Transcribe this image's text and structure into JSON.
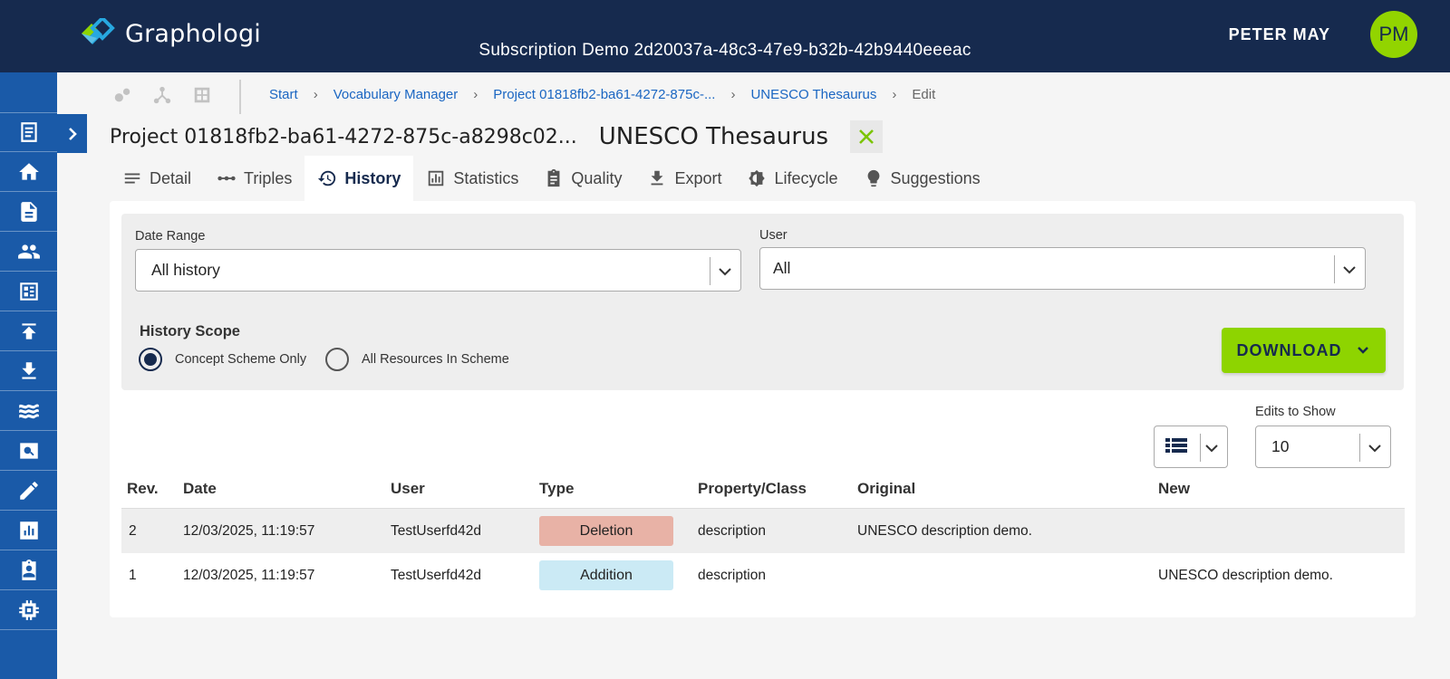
{
  "app": {
    "name": "Graphologi"
  },
  "header": {
    "subscription": "Subscription Demo 2d20037a-48c3-47e9-b32b-42b9440eeeac",
    "user_name": "PETER MAY",
    "avatar_initials": "PM"
  },
  "sidebar": {
    "items": [
      {
        "icon": "vocabulary-icon"
      },
      {
        "icon": "home-icon"
      },
      {
        "icon": "document-icon"
      },
      {
        "icon": "users-icon"
      },
      {
        "icon": "dashboard-icon"
      },
      {
        "icon": "upload-icon"
      },
      {
        "icon": "download-icon"
      },
      {
        "icon": "waves-icon"
      },
      {
        "icon": "search-box-icon"
      },
      {
        "icon": "pencil-icon"
      },
      {
        "icon": "chart-icon"
      },
      {
        "icon": "badge-icon"
      },
      {
        "icon": "chip-icon"
      }
    ]
  },
  "breadcrumb": {
    "items": [
      "Start",
      "Vocabulary Manager",
      "Project 01818fb2-ba61-4272-875c-...",
      "UNESCO Thesaurus"
    ],
    "current": "Edit"
  },
  "title": {
    "project": "Project 01818fb2-ba61-4272-875c-a8298c02...",
    "scheme": "UNESCO Thesaurus"
  },
  "tabs": [
    {
      "label": "Detail",
      "icon": "list-lines-icon",
      "active": false
    },
    {
      "label": "Triples",
      "icon": "dots-line-icon",
      "active": false
    },
    {
      "label": "History",
      "icon": "history-icon",
      "active": true
    },
    {
      "label": "Statistics",
      "icon": "bar-chart-icon",
      "active": false
    },
    {
      "label": "Quality",
      "icon": "clipboard-icon",
      "active": false
    },
    {
      "label": "Export",
      "icon": "export-icon",
      "active": false
    },
    {
      "label": "Lifecycle",
      "icon": "lifecycle-icon",
      "active": false
    },
    {
      "label": "Suggestions",
      "icon": "lightbulb-icon",
      "active": false
    }
  ],
  "filters": {
    "date_range_label": "Date Range",
    "date_range_value": "All history",
    "user_label": "User",
    "user_value": "All",
    "scope_title": "History Scope",
    "scope_options": [
      {
        "label": "Concept Scheme Only",
        "checked": true
      },
      {
        "label": "All Resources In Scheme",
        "checked": false
      }
    ],
    "download_label": "DOWNLOAD"
  },
  "edits": {
    "label": "Edits to Show",
    "value": "10"
  },
  "table": {
    "headers": [
      "Rev.",
      "Date",
      "User",
      "Type",
      "Property/Class",
      "Original",
      "New"
    ],
    "rows": [
      {
        "rev": "2",
        "date": "12/03/2025, 11:19:57",
        "user": "TestUserfd42d",
        "type": "Deletion",
        "type_color": "#e8b2a6",
        "property": "description",
        "original": "UNESCO description demo.",
        "new": ""
      },
      {
        "rev": "1",
        "date": "12/03/2025, 11:19:57",
        "user": "TestUserfd42d",
        "type": "Addition",
        "type_color": "#cbeaf5",
        "property": "description",
        "original": "",
        "new": "UNESCO description demo."
      }
    ]
  },
  "colors": {
    "header_bg": "#162a4e",
    "sidebar_bg": "#1a5aa8",
    "accent_green": "#8ed400",
    "link_blue": "#1a66c2"
  }
}
